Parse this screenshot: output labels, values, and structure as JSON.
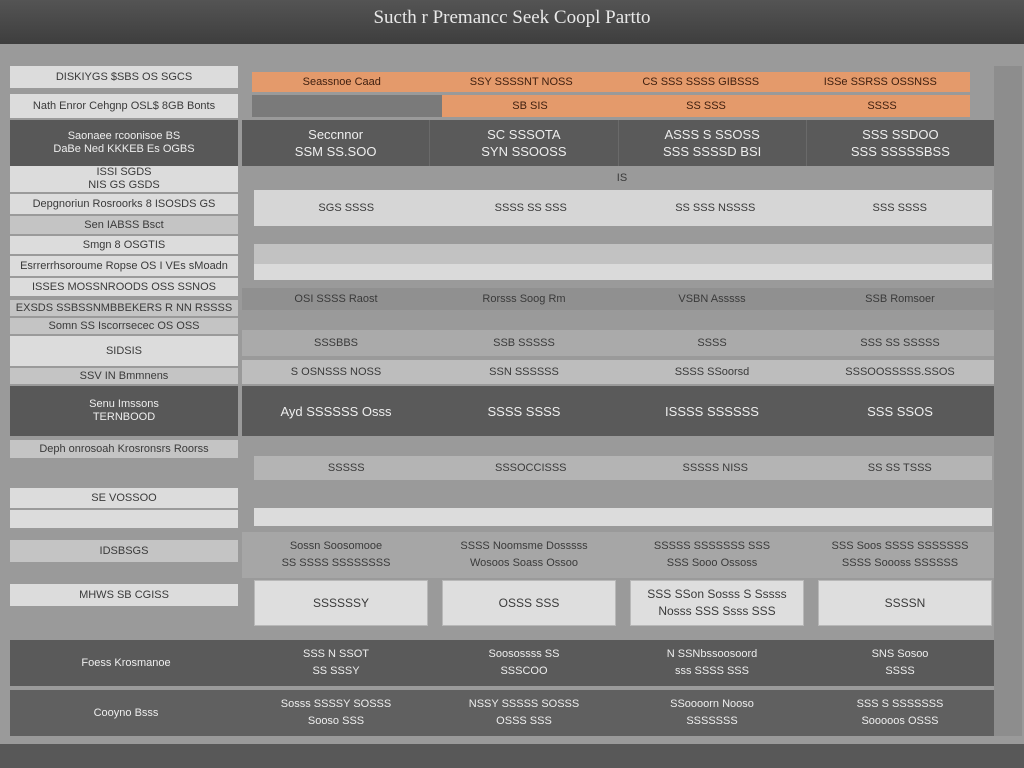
{
  "window": {
    "title": "Sucth r Premancc Seek Coopl Partto"
  },
  "sidebar": {
    "items": [
      "DISKIYGS $SBS OS SGCS",
      "Nath Enror Cehgnp OSL$ 8GB Bonts",
      "Saonaee rcoonisoe BS\nDaBe Ned KKKEB Es OGBS",
      "ISSI SGDS\nNIS GS GSDS",
      "Depgnoriun Rosroorks 8 ISOSDS GS",
      "Sen IABSS Bsct",
      "Smgn 8 OSGTIS",
      "Esrrerrhsoroume Ropse OS I VEs sMoadn",
      "ISSES MOSSNROODS OSS SSNOS",
      "EXSDS SSBSSNMBBEKERS R NN RSSSS",
      "Somn SS Iscorrsecec OS OSS",
      "SIDSIS",
      "SSV IN Bmmnens",
      "Senu Imssons\nTERNBOOD",
      "Deph onrosoah Krosronsrs Roorss",
      "SE VOSSOO",
      "IDSBSGS",
      "MHWS SB CGISS"
    ]
  },
  "header": {
    "orange_row_1": [
      "Seassnoe Caad",
      "SSY SSSSNT NOSS",
      "CS SSS SSSS GIBSSS",
      "ISSe SSRSS OSSNSS"
    ],
    "orange_row_2": [
      "SB SIS",
      "SS SSS",
      "SSSS"
    ]
  },
  "rows": {
    "row1": [
      [
        "Seccnnor",
        "SSM SS.SOO"
      ],
      [
        "SC SSSOTA",
        "SYN SSOOSS"
      ],
      [
        "ASSS S SSOSS",
        "SSS SSSSD BSI"
      ],
      [
        "SSS SSDOO",
        "SSS SSSSSBSS"
      ]
    ],
    "row2_center": "IS",
    "row3": [
      "SGS SSSS",
      "SSSS SS SSS",
      "SS SSS NSSSS",
      "SSS SSSS"
    ],
    "row4": [
      "OSI SSSS Raost",
      "Rorsss Soog Rm",
      "VSBN Asssss",
      "SSB Romsoer"
    ],
    "row5": [
      "SSSBBS",
      "SSB SSSSS",
      "SSSS",
      "SSS SS SSSSS"
    ],
    "row6": [
      "S OSNSSS NOSS",
      "SSN SSSSSS",
      "SSSS SSoorsd",
      "SSSOOSSSSS.SSOS"
    ],
    "row7": [
      "Ayd SSSSSS Osss",
      "SSSS SSSS",
      "ISSSS SSSSSS",
      "SSS SSOS"
    ],
    "row8": [
      "SSSSS",
      "SSSOCCISSS",
      "SSSSS NISS",
      "SS SS TSSS"
    ],
    "row9": [
      [
        "Sossn Soosomooe",
        "SS SSSS SSSSSSSS"
      ],
      [
        "SSSS Noomsme Dosssss",
        "Wosoos Soass Ossoo"
      ],
      [
        "SSSSS SSSSSSS SSS",
        "SSS Sooo Ossoss"
      ],
      [
        "SSS Soos SSSS SSSSSSS",
        "SSSS Soooss SSSSSS"
      ]
    ],
    "row10": [
      "SSSSSSY",
      "OSSS SSS",
      [
        "SSS SSon Sosss S Sssss",
        "Nosss SSS Ssss SSS"
      ],
      "SSSSN"
    ]
  },
  "footer": {
    "row1": {
      "label": "Foess Krosmanoe",
      "cells": [
        [
          "SSS N SSOT",
          "SS SSSY"
        ],
        [
          "Soosossss SS",
          "SSSCOO"
        ],
        [
          "N SSNbssoosoord",
          "sss SSSS SSS"
        ],
        [
          "SNS Sosoo",
          "SSSS"
        ]
      ]
    },
    "row2": {
      "label": "Cooyno Bsss",
      "cells": [
        [
          "Sosss SSSSY SOSSS",
          "Sooso SSS"
        ],
        [
          "NSSY SSSSS SOSSS",
          "OSSS SSS"
        ],
        [
          "SSoooorn Nooso",
          "SSSSSSS"
        ],
        [
          "SSS S SSSSSSS",
          "Sooooos OSSS"
        ]
      ]
    }
  }
}
